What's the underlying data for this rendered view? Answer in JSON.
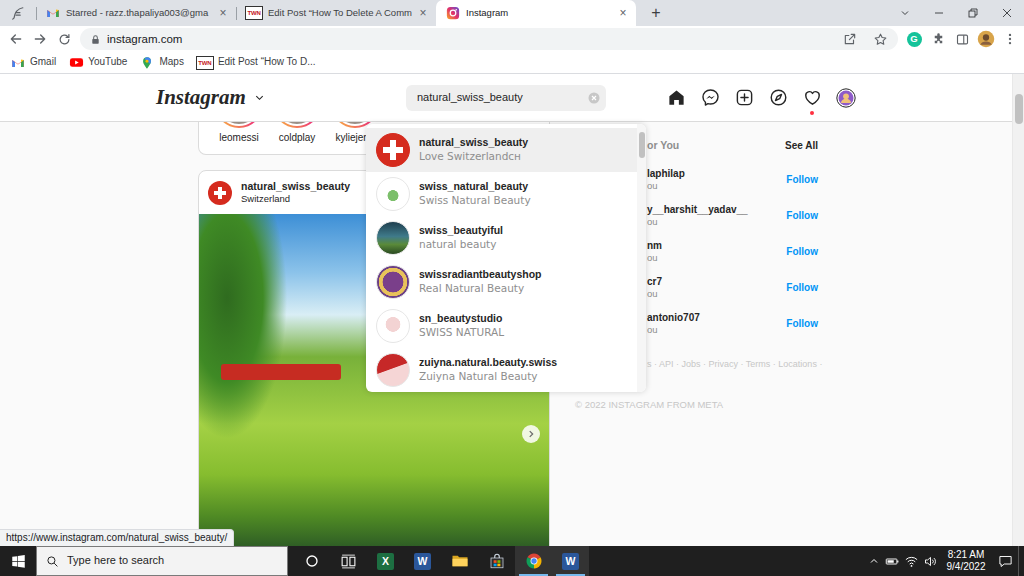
{
  "browser": {
    "tabs": [
      {
        "kind": "pinned",
        "selected": false
      },
      {
        "kind": "gmail",
        "label": "Starred - razz.thapaliya003@gma",
        "selected": false
      },
      {
        "kind": "twn",
        "badge": "TWN",
        "label": "Edit Post “How To Delete A Comm",
        "selected": false
      },
      {
        "kind": "instagram",
        "label": "Instagram",
        "selected": true
      }
    ],
    "close_glyph": "×",
    "new_tab_glyph": "+",
    "address": "instagram.com",
    "grammarly_glyph": "G",
    "bookmarks": [
      {
        "kind": "gmail",
        "label": "Gmail"
      },
      {
        "kind": "youtube",
        "label": "YouTube"
      },
      {
        "kind": "maps",
        "label": "Maps"
      },
      {
        "kind": "twn",
        "badge": "TWN",
        "label": "Edit Post “How To D..."
      }
    ],
    "status_url": "https://www.instagram.com/natural_swiss_beauty/"
  },
  "instagram": {
    "logo": "Instagram",
    "search": {
      "value": "natural_swiss_beauty"
    },
    "notifications": {
      "unread": true
    },
    "stories": [
      {
        "label": "leomessi"
      },
      {
        "label": "coldplay"
      },
      {
        "label": "kyliejenn"
      }
    ],
    "post": {
      "user": "natural_swiss_beauty",
      "location": "Switzerland"
    },
    "suggestions": {
      "title": "or You",
      "see_all": "See All",
      "items": [
        {
          "user": "laphilap",
          "note": "ou",
          "action": "Follow"
        },
        {
          "user": "y__harshit__yadav__",
          "note": "ou",
          "action": "Follow"
        },
        {
          "user": "nm",
          "note": "ou",
          "action": "Follow"
        },
        {
          "user": "cr7",
          "note": "ou",
          "action": "Follow"
        },
        {
          "user": "antonio707",
          "note": "ou",
          "action": "Follow"
        }
      ]
    },
    "footer": {
      "links": "s · API · Jobs · Privacy · Terms · Locations ·",
      "copyright": "© 2022 INSTAGRAM FROM META"
    },
    "results": [
      {
        "user": "natural_swiss_beauty",
        "name": "Love Switzerlandᴄʜ",
        "selected": true
      },
      {
        "user": "swiss_natural_beauty",
        "name": "Swiss Natural Beauty",
        "selected": false
      },
      {
        "user": "swiss_beautyiful",
        "name": "natural beauty",
        "selected": false
      },
      {
        "user": "swissradiantbeautyshop",
        "name": "Real Natural Beauty",
        "selected": false
      },
      {
        "user": "sn_beautystudio",
        "name": "SWISS NATURAL",
        "selected": false
      },
      {
        "user": "zuiyna.natural.beauty.swiss",
        "name": "Zuiyna Natural Beauty",
        "selected": false
      }
    ]
  },
  "taskbar": {
    "search_placeholder": "Type here to search",
    "apps": [
      {
        "kind": "cortana",
        "running": false
      },
      {
        "kind": "taskview",
        "running": false
      },
      {
        "kind": "excel",
        "glyph": "X",
        "running": false
      },
      {
        "kind": "word",
        "glyph": "W",
        "running": false
      },
      {
        "kind": "explorer",
        "running": false
      },
      {
        "kind": "store",
        "running": false
      },
      {
        "kind": "chrome",
        "running": true
      },
      {
        "kind": "word",
        "glyph": "W",
        "running": true
      }
    ],
    "time": "8:21 AM",
    "date": "9/4/2022"
  }
}
